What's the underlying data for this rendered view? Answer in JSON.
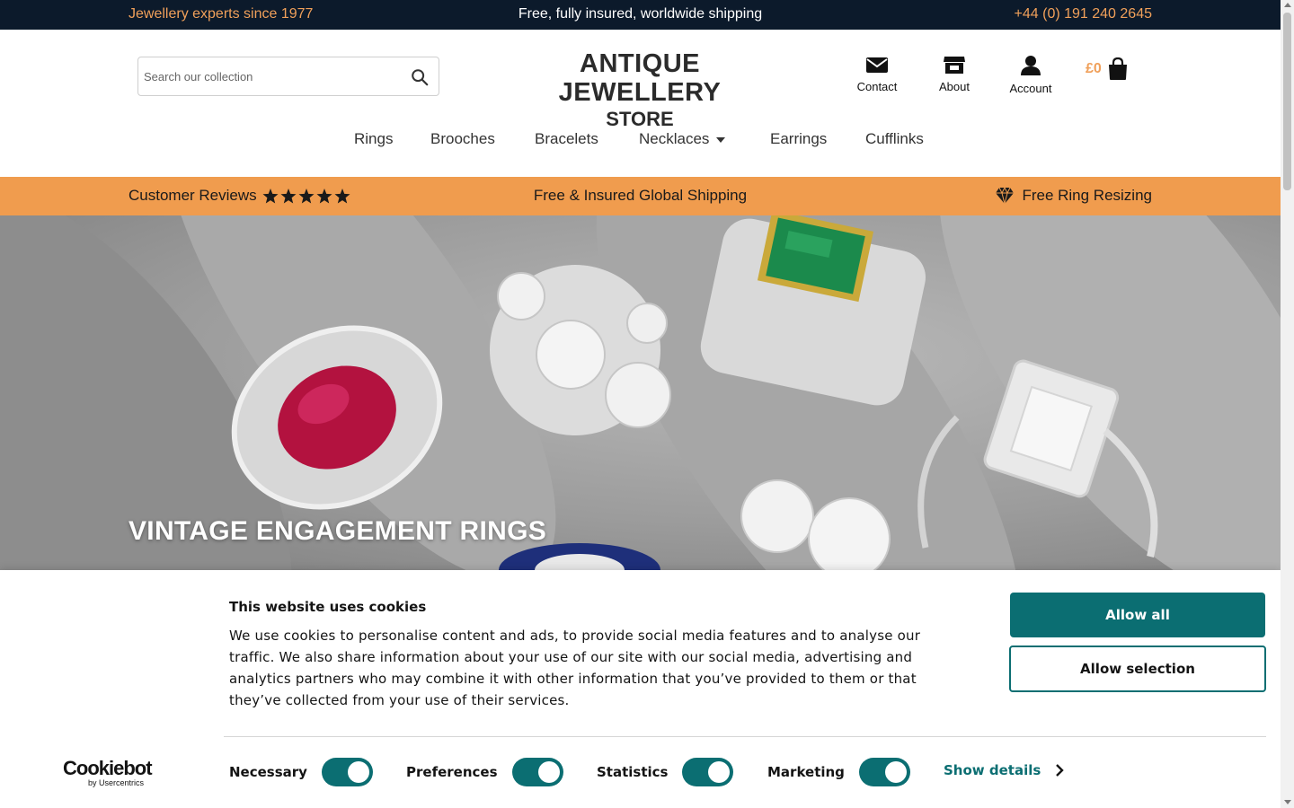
{
  "topbar": {
    "left_text": "Jewellery experts since 1977",
    "center_text": "Free, fully insured, worldwide shipping",
    "phone": "+44 (0) 191 240 2645"
  },
  "header": {
    "search_placeholder": "Search our collection",
    "logo_line1": "ANTIQUE JEWELLERY",
    "logo_line2": "STORE",
    "icons": [
      {
        "label": "Contact",
        "icon": "envelope-icon"
      },
      {
        "label": "About",
        "icon": "store-icon"
      },
      {
        "label": "Account",
        "icon": "user-icon"
      }
    ],
    "cart_amount": "£0"
  },
  "nav": {
    "items": [
      "Rings",
      "Brooches",
      "Bracelets",
      "Necklaces",
      "Earrings",
      "Cufflinks"
    ]
  },
  "promo": {
    "reviews_label": "Customer Reviews",
    "rating_stars": 5,
    "shipping_label": "Free & Insured Global Shipping",
    "resizing_label": "Free Ring Resizing"
  },
  "hero": {
    "title": "VINTAGE ENGAGEMENT RINGS"
  },
  "cookie": {
    "title": "This website uses cookies",
    "body": "We use cookies to personalise content and ads, to provide social media features and to analyse our traffic. We also share information about your use of our site with our social media, advertising and analytics partners who may combine it with other information that you’ve provided to them or that they’ve collected from your use of their services.",
    "allow_all": "Allow all",
    "allow_selection": "Allow selection",
    "categories": [
      {
        "label": "Necessary",
        "enabled": true
      },
      {
        "label": "Preferences",
        "enabled": true
      },
      {
        "label": "Statistics",
        "enabled": true
      },
      {
        "label": "Marketing",
        "enabled": true
      }
    ],
    "show_details": "Show details",
    "brand": "Cookiebot",
    "brand_sub": "by Usercentrics"
  },
  "colors": {
    "topbar_bg": "#0c1a2b",
    "accent_orange": "#f09c4e",
    "teal": "#0b6e72"
  }
}
